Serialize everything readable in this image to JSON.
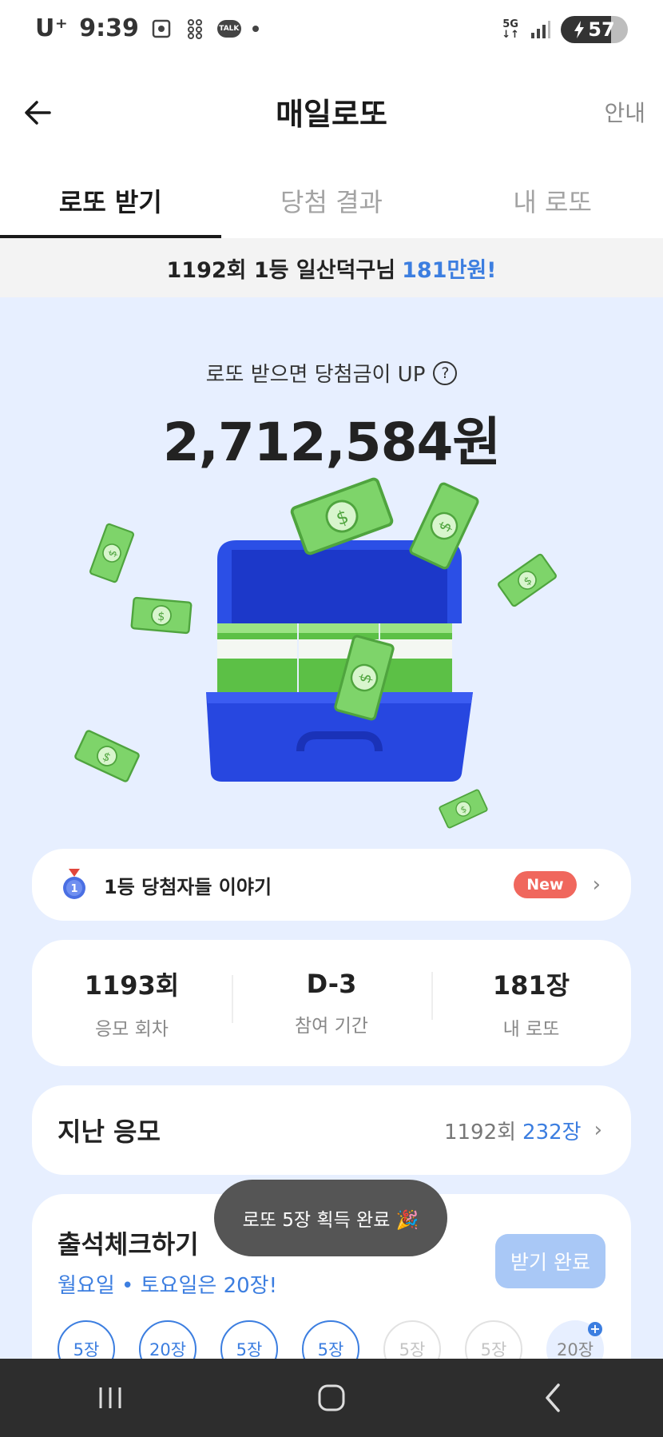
{
  "status_bar": {
    "carrier": "U⁺",
    "time": "9:39",
    "talk": "TALK",
    "network": "5G",
    "battery": "57"
  },
  "header": {
    "title": "매일로또",
    "guide": "안내"
  },
  "tabs": [
    {
      "label": "로또 받기"
    },
    {
      "label": "당첨 결과"
    },
    {
      "label": "내 로또"
    }
  ],
  "banner": {
    "text": "1192회 1등 일산덕구님",
    "amount": "181만원!"
  },
  "prize": {
    "caption": "로또 받으면 당첨금이 UP",
    "amount": "2,712,584원"
  },
  "winners": {
    "title": "1등 당첨자들 이야기",
    "badge": "New"
  },
  "stats": [
    {
      "value": "1193회",
      "label": "응모 회차"
    },
    {
      "value": "D-3",
      "label": "참여 기간"
    },
    {
      "value": "181장",
      "label": "내 로또"
    }
  ],
  "past": {
    "title": "지난 응모",
    "round": "1192회",
    "count": "232장"
  },
  "attendance": {
    "title": "출석체크하기",
    "subtitle": "월요일 • 토요일은 20장!",
    "button": "받기 완료",
    "days": [
      "5장",
      "20장",
      "5장",
      "5장",
      "5장",
      "5장",
      "20장"
    ]
  },
  "toast": {
    "text": "로또 5장 획득 완료 🎉"
  },
  "colors": {
    "accent": "#3c7ee0",
    "background": "#e7efff",
    "badge": "#f0675d"
  }
}
